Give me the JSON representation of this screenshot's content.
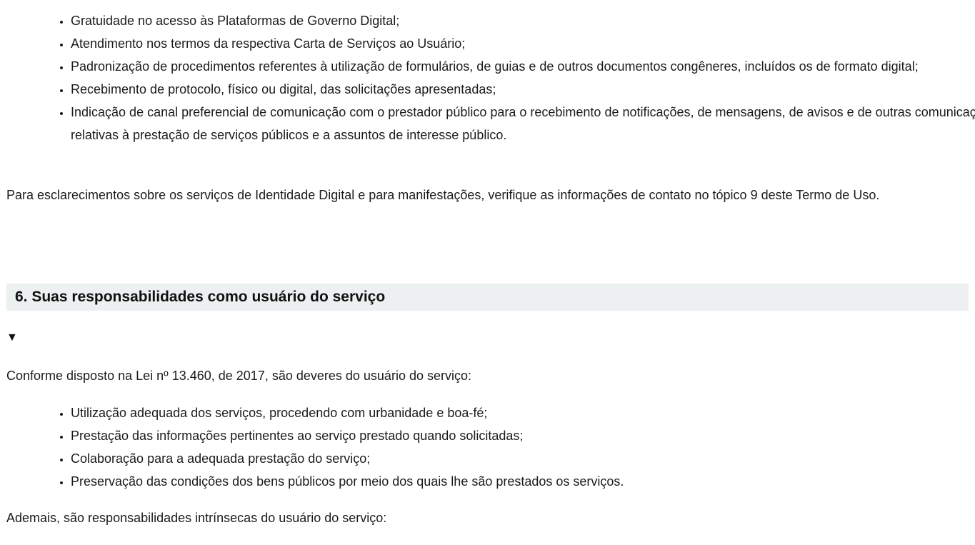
{
  "rights_list": [
    "Gratuidade no acesso às Plataformas de Governo Digital;",
    "Atendimento nos termos da respectiva Carta de Serviços ao Usuário;",
    "Padronização de procedimentos referentes à utilização de formulários, de guias e de outros documentos congêneres, incluídos os de formato digital;",
    "Recebimento de protocolo, físico ou digital, das solicitações apresentadas;",
    "Indicação de canal preferencial de comunicação com o prestador público para o recebimento de notificações, de mensagens, de avisos e de outras comunicações relativas à prestação de serviços públicos e a assuntos de interesse público."
  ],
  "contact_paragraph": "Para esclarecimentos sobre os serviços de Identidade Digital e para manifestações, verifique as informações de contato no tópico 9 deste Termo de Uso.",
  "section6": {
    "title": "6. Suas responsabilidades como usuário do serviço",
    "toggle_symbol": "▼",
    "intro": "Conforme disposto na Lei nº 13.460, de 2017, são deveres do usuário do serviço:",
    "duties": [
      "Utilização adequada dos serviços, procedendo com urbanidade e boa-fé;",
      "Prestação das informações pertinentes ao serviço prestado quando solicitadas;",
      "Colaboração para a adequada prestação do serviço;",
      "Preservação das condições dos bens públicos por meio dos quais lhe são prestados os serviços."
    ],
    "additional": "Ademais, são responsabilidades intrínsecas do usuário do serviço:"
  }
}
